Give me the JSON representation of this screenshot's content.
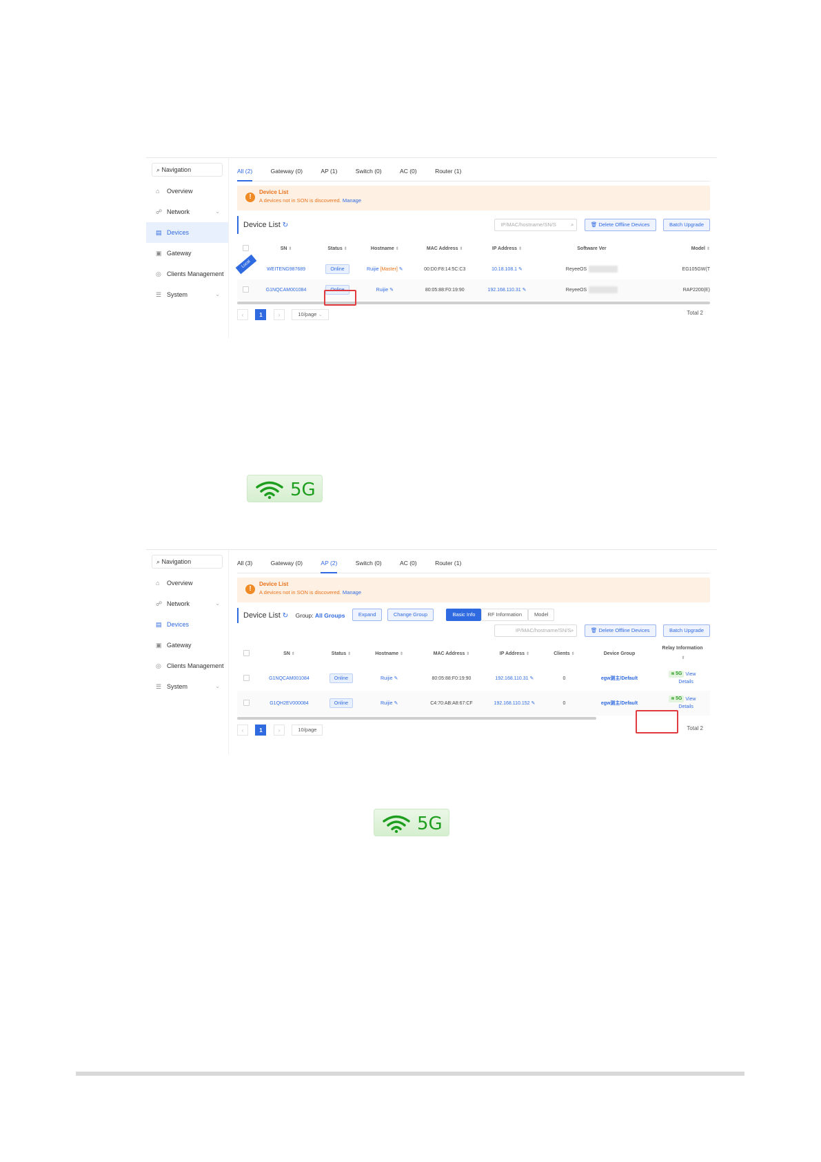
{
  "nav": {
    "search_label": "Navigation",
    "items": [
      {
        "label": "Overview",
        "icon": "home-icon"
      },
      {
        "label": "Network",
        "icon": "network-icon",
        "chevron": true
      },
      {
        "label": "Devices",
        "icon": "devices-icon",
        "active": true
      },
      {
        "label": "Gateway",
        "icon": "gateway-icon"
      },
      {
        "label": "Clients Management",
        "icon": "clients-icon"
      },
      {
        "label": "System",
        "icon": "system-icon",
        "chevron": true
      }
    ]
  },
  "screen1": {
    "tabs": [
      "All (2)",
      "Gateway (0)",
      "AP (1)",
      "Switch (0)",
      "AC (0)",
      "Router (1)"
    ],
    "alert_title": "Device List",
    "alert_message": "A devices not in SON is discovered.",
    "alert_link": "Manage",
    "list_title": "Device List",
    "search_placeholder": "IP/MAC/hostname/SN/S",
    "delete_button": "Delete Offline Devices",
    "upgrade_button": "Batch Upgrade",
    "columns": [
      "SN",
      "Status",
      "Hostname",
      "MAC Address",
      "IP Address",
      "Software Ver",
      "Model"
    ],
    "local_label": "Local",
    "rows": [
      {
        "sn": "WEITENG987689",
        "status": "Online",
        "hostname": "Ruijie",
        "hostname_tag": "[Master]",
        "mac": "00:D0:F8:14:5C:C3",
        "ip": "10.18.108.1",
        "software": "ReyeeOS",
        "model": "EG105GW(T"
      },
      {
        "sn": "G1NQCAM001084",
        "status": "Online",
        "hostname": "Ruijie",
        "hostname_tag": "",
        "mac": "80:05:88:F0:19:90",
        "ip": "192.168.110.31",
        "software": "ReyeeOS",
        "model": "RAP2200(E)"
      }
    ],
    "page": "1",
    "page_size": "10/page",
    "total": "Total 2"
  },
  "screen2": {
    "tabs": [
      "All (3)",
      "Gateway (0)",
      "AP (2)",
      "Switch (0)",
      "AC (0)",
      "Router (1)"
    ],
    "alert_title": "Device List",
    "alert_message": "A devices not in SON is discovered.",
    "alert_link": "Manage",
    "list_title": "Device List",
    "group_label": "Group:",
    "group_value": "All Groups",
    "expand_button": "Expand",
    "change_group_button": "Change Group",
    "view_tabs": [
      "Basic Info",
      "RF Information",
      "Model"
    ],
    "search_placeholder": "IP/MAC/hostname/SN/S",
    "delete_button": "Delete Offline Devices",
    "upgrade_button": "Batch Upgrade",
    "columns": [
      "SN",
      "Status",
      "Hostname",
      "MAC Address",
      "IP Address",
      "Clients",
      "Device Group",
      "Relay Information"
    ],
    "rows": [
      {
        "sn": "G1NQCAM001084",
        "status": "Online",
        "hostname": "Ruijie",
        "mac": "80:05:88:F0:19:90",
        "ip": "192.168.110.31",
        "clients": "0",
        "group": "egw测主/Default",
        "relay_band": "5G",
        "relay_view": "View",
        "relay_details": "Details"
      },
      {
        "sn": "G1QH2EV000084",
        "status": "Online",
        "hostname": "Ruijie",
        "mac": "C4:70:AB:A8:67:CF",
        "ip": "192.168.110.152",
        "clients": "0",
        "group": "egw测主/Default",
        "relay_band": "5G",
        "relay_view": "View",
        "relay_details": "Details"
      }
    ],
    "page": "1",
    "page_size": "10/page",
    "total": "Total 2"
  },
  "icons": {
    "badge_1": "5G",
    "badge_2": "5G"
  },
  "colors": {
    "accent": "#2f6ae0",
    "alert": "#e8731a",
    "highlight": "#e0393e",
    "wifi_green": "#1e9e1e"
  }
}
